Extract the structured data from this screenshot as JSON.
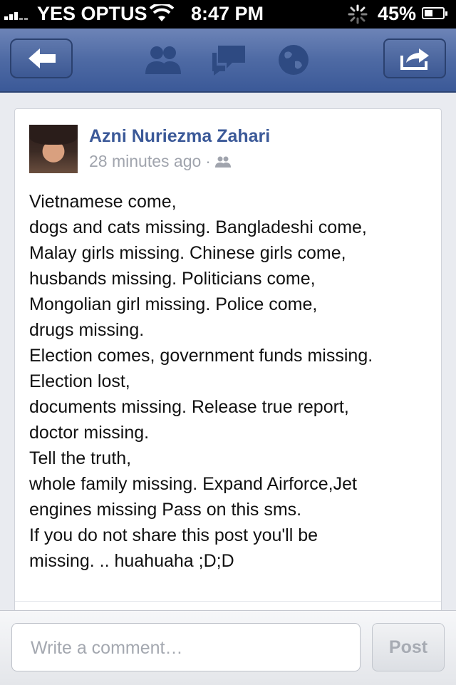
{
  "status_bar": {
    "carrier": "YES OPTUS",
    "time": "8:47 PM",
    "battery": "45%",
    "battery_level": 0.45
  },
  "nav": {
    "icons": [
      "back-arrow-icon",
      "friends-icon",
      "messages-icon",
      "globe-icon",
      "share-icon"
    ]
  },
  "post": {
    "author": "Azni Nuriezma Zahari",
    "timestamp": "28 minutes ago",
    "separator": "·",
    "lines": [
      "Vietnamese come,",
      "dogs and cats missing. Bangladeshi come,",
      "Malay girls missing. Chinese girls come,",
      "husbands missing. Politicians come,",
      "Mongolian girl missing. Police come,",
      "drugs missing.",
      "Election comes, government funds missing.",
      "Election lost,",
      "documents missing. Release true report,",
      "doctor missing.",
      "Tell the truth,",
      "whole family missing. Expand Airforce,Jet",
      "engines missing Pass on this sms.",
      "If you do not share this post you'll be",
      "missing. .. huahuaha ;D;D"
    ]
  },
  "comment_bar": {
    "placeholder": "Write a comment…",
    "post_label": "Post"
  }
}
